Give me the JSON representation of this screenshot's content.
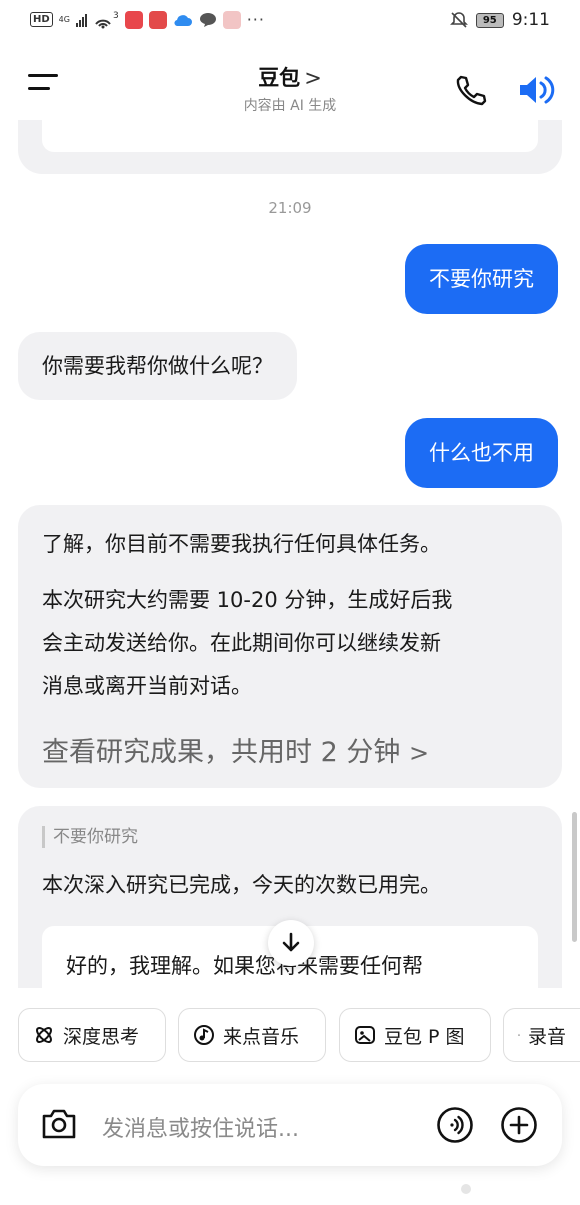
{
  "status_bar": {
    "hd": "HD",
    "network": "4G",
    "hotspot_count": "3",
    "more": "···",
    "battery": "95",
    "time": "9:11"
  },
  "header": {
    "title": "豆包",
    "subtitle": "内容由 AI 生成",
    "title_chevron": ">"
  },
  "chat": {
    "timestamp": "21:09",
    "user_msg_1": "不要你研究",
    "bot_msg_1": "你需要我帮你做什么呢？",
    "user_msg_2": "什么也不用",
    "bot_msg_2": {
      "para1": "了解，你目前不需要我执行任何具体任务。",
      "para2_line1": "本次研究大约需要 10-20 分钟，生成好后我",
      "para2_line2": "会主动发送给你。在此期间你可以继续发新",
      "para2_line3": "消息或离开当前对话。",
      "view_link": "查看研究成果，共用时 2 分钟",
      "view_link_chevron": ">"
    },
    "bot_msg_3": {
      "quote": "不要你研究",
      "text": "本次深入研究已完成，今天的次数已用完。",
      "inner_text": "好的，我理解。如果您将来需要任何帮"
    }
  },
  "quick_actions": [
    {
      "label": "深度思考",
      "icon": "atom-icon"
    },
    {
      "label": "来点音乐",
      "icon": "music-icon"
    },
    {
      "label": "豆包 P 图",
      "icon": "image-edit-icon"
    },
    {
      "label": "录音",
      "icon": "mic-icon"
    }
  ],
  "input": {
    "placeholder": "发消息或按住说话..."
  },
  "colors": {
    "accent": "#1c6cf4",
    "bubble_bot": "#f1f1f3"
  }
}
